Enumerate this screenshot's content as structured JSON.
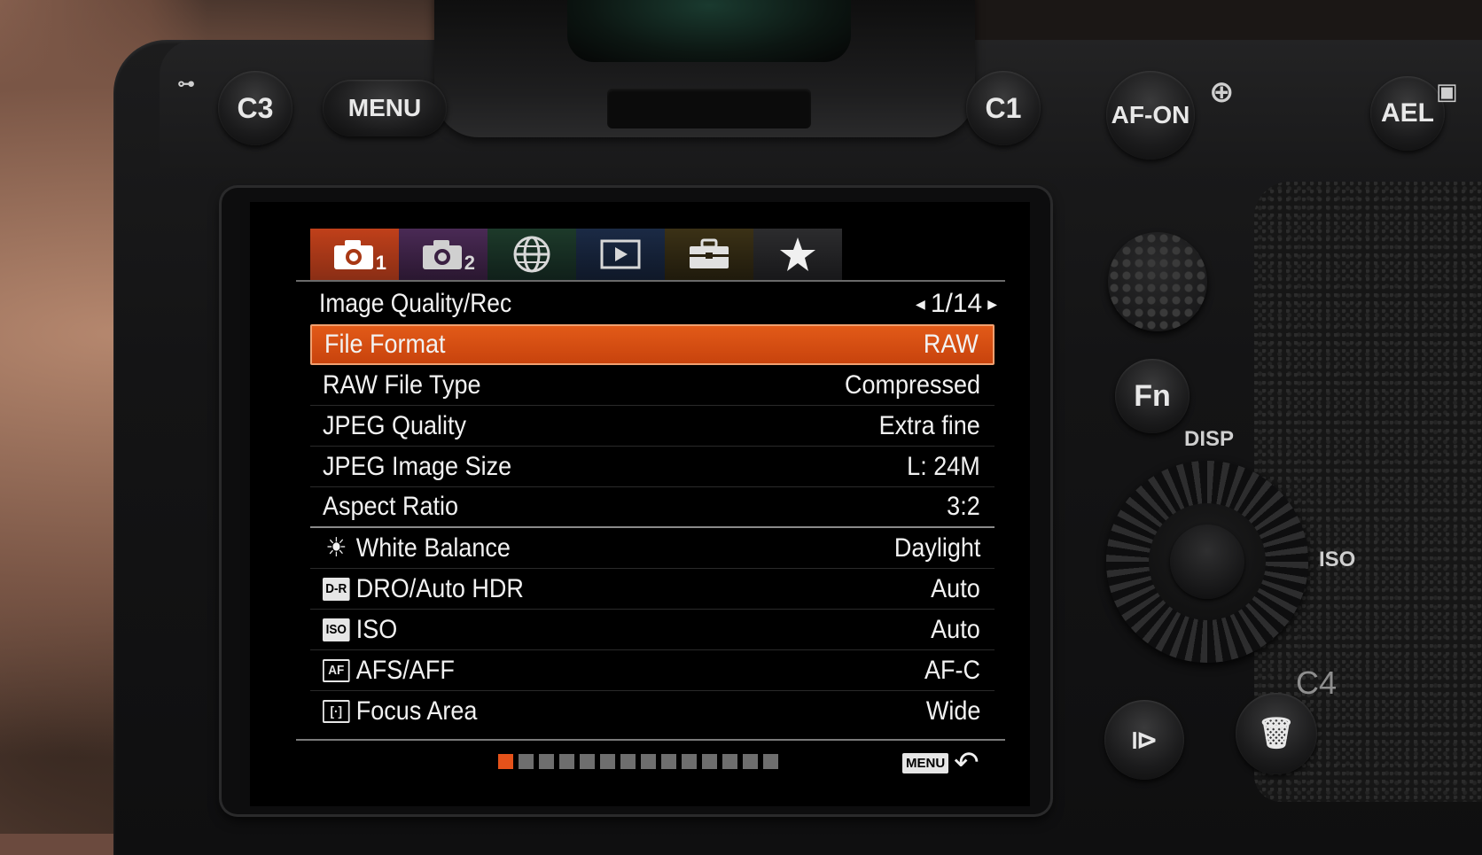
{
  "hardware": {
    "c3": "C3",
    "menu": "MENU",
    "c1": "C1",
    "af_on": "AF-ON",
    "ael": "AEL",
    "fn": "Fn",
    "disp": "DISP",
    "iso": "ISO",
    "c4": "C4"
  },
  "tabs": [
    {
      "icon": "camera-icon",
      "sub": "1",
      "color": "#c0401a"
    },
    {
      "icon": "camera-icon",
      "sub": "2",
      "color": "#4a2a55"
    },
    {
      "icon": "globe-icon",
      "sub": "",
      "color": "#1d3a2a"
    },
    {
      "icon": "play-icon",
      "sub": "",
      "color": "#1b2a45"
    },
    {
      "icon": "toolbox-icon",
      "sub": "",
      "color": "#3b3116"
    },
    {
      "icon": "star-icon",
      "sub": "",
      "color": "#2c2c2e"
    }
  ],
  "menu": {
    "title": "Image Quality/Rec",
    "page": "1/14",
    "items": [
      {
        "label": "File Format",
        "value": "RAW",
        "icon": ""
      },
      {
        "label": "RAW File Type",
        "value": "Compressed",
        "icon": ""
      },
      {
        "label": "JPEG Quality",
        "value": "Extra fine",
        "icon": ""
      },
      {
        "label": "JPEG Image Size",
        "value": "L: 24M",
        "icon": ""
      },
      {
        "label": "Aspect Ratio",
        "value": "3:2",
        "icon": ""
      },
      {
        "label": "White Balance",
        "value": "Daylight",
        "icon": "sun-icon"
      },
      {
        "label": "DRO/Auto HDR",
        "value": "Auto",
        "icon": "dr-icon",
        "icon_text": "D-R"
      },
      {
        "label": "ISO",
        "value": "Auto",
        "icon": "iso-icon",
        "icon_text": "ISO"
      },
      {
        "label": "AFS/AFF",
        "value": "AF-C",
        "icon": "af-icon",
        "icon_text": "AF"
      },
      {
        "label": "Focus Area",
        "value": "Wide",
        "icon": "focus-area-icon",
        "icon_text": "[·]"
      }
    ],
    "selected_index": 0,
    "page_count": 14,
    "current_page": 1,
    "back_chip": "MENU"
  },
  "colors": {
    "accent": "#e25a18",
    "page_on": "#e5521a"
  }
}
